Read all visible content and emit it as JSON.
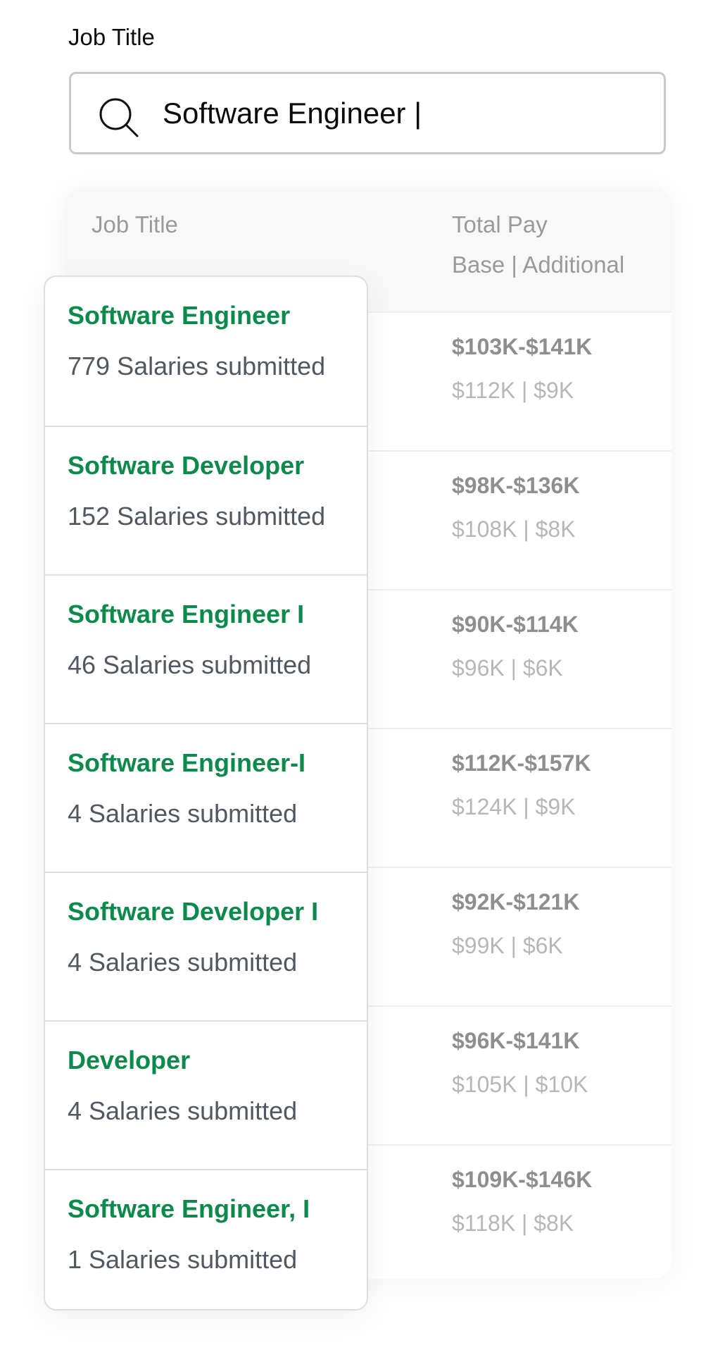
{
  "field_label": "Job Title",
  "search": {
    "value": "Software Engineer |"
  },
  "table": {
    "header": {
      "job_title": "Job Title",
      "total_pay": "Total Pay",
      "base_additional": "Base | Additional"
    },
    "rows": [
      {
        "range": "$103K-$141K",
        "split": "$112K | $9K"
      },
      {
        "range": "$98K-$136K",
        "split": "$108K | $8K"
      },
      {
        "range": "$90K-$114K",
        "split": "$96K | $6K"
      },
      {
        "range": "$112K-$157K",
        "split": "$124K | $9K"
      },
      {
        "range": "$92K-$121K",
        "split": "$99K | $6K"
      },
      {
        "range": "$96K-$141K",
        "split": "$105K | $10K"
      },
      {
        "range": "$109K-$146K",
        "split": "$118K | $8K"
      }
    ]
  },
  "suggestions": [
    {
      "title": "Software Engineer",
      "count": "779 Salaries submitted"
    },
    {
      "title": "Software Developer",
      "count": "152 Salaries submitted"
    },
    {
      "title": "Software Engineer I",
      "count": "46 Salaries submitted"
    },
    {
      "title": "Software Engineer-I",
      "count": "4 Salaries submitted"
    },
    {
      "title": "Software Developer I",
      "count": "4 Salaries submitted"
    },
    {
      "title": "Developer",
      "count": "4 Salaries submitted"
    },
    {
      "title": "Software Engineer, I",
      "count": "1 Salaries submitted"
    }
  ],
  "colors": {
    "accent_green": "#0c8a4c",
    "muted_text": "#505861",
    "pay_range": "#8e8e8e",
    "pay_split": "#b7b7b7"
  },
  "icons": {
    "search": "search-icon"
  }
}
